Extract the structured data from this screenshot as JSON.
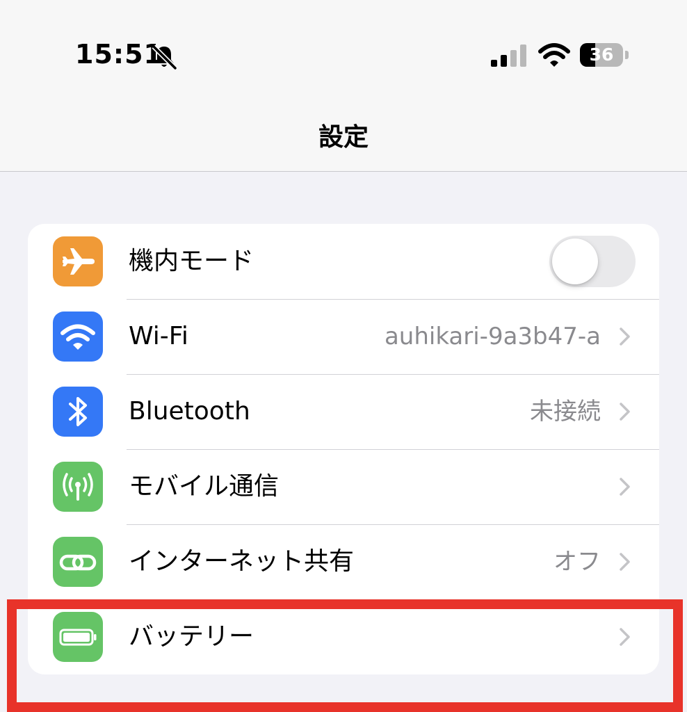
{
  "status_bar": {
    "time": "15:51",
    "silent_icon": "bell-slash-icon",
    "signal_icon": "cellular-signal-icon",
    "wifi_icon": "wifi-icon",
    "battery_level": "36",
    "battery_fraction": 0.36
  },
  "header": {
    "title": "設定"
  },
  "settings": {
    "items": [
      {
        "label": "機内モード",
        "icon": "airplane-icon",
        "icon_color": "#f09a37",
        "control": "toggle",
        "toggle_on": false
      },
      {
        "label": "Wi-Fi",
        "icon": "wifi-icon",
        "icon_color": "#3478f6",
        "value": "auhikari-9a3b47-a",
        "control": "chevron"
      },
      {
        "label": "Bluetooth",
        "icon": "bluetooth-icon",
        "icon_color": "#3478f6",
        "value": "未接続",
        "control": "chevron"
      },
      {
        "label": "モバイル通信",
        "icon": "antenna-icon",
        "icon_color": "#65c466",
        "control": "chevron"
      },
      {
        "label": "インターネット共有",
        "icon": "personal-hotspot-icon",
        "icon_color": "#65c466",
        "value": "オフ",
        "control": "chevron"
      },
      {
        "label": "バッテリー",
        "icon": "battery-icon",
        "icon_color": "#65c466",
        "control": "chevron"
      }
    ]
  },
  "highlight": {
    "color": "#e8332a",
    "target": "バッテリー"
  }
}
